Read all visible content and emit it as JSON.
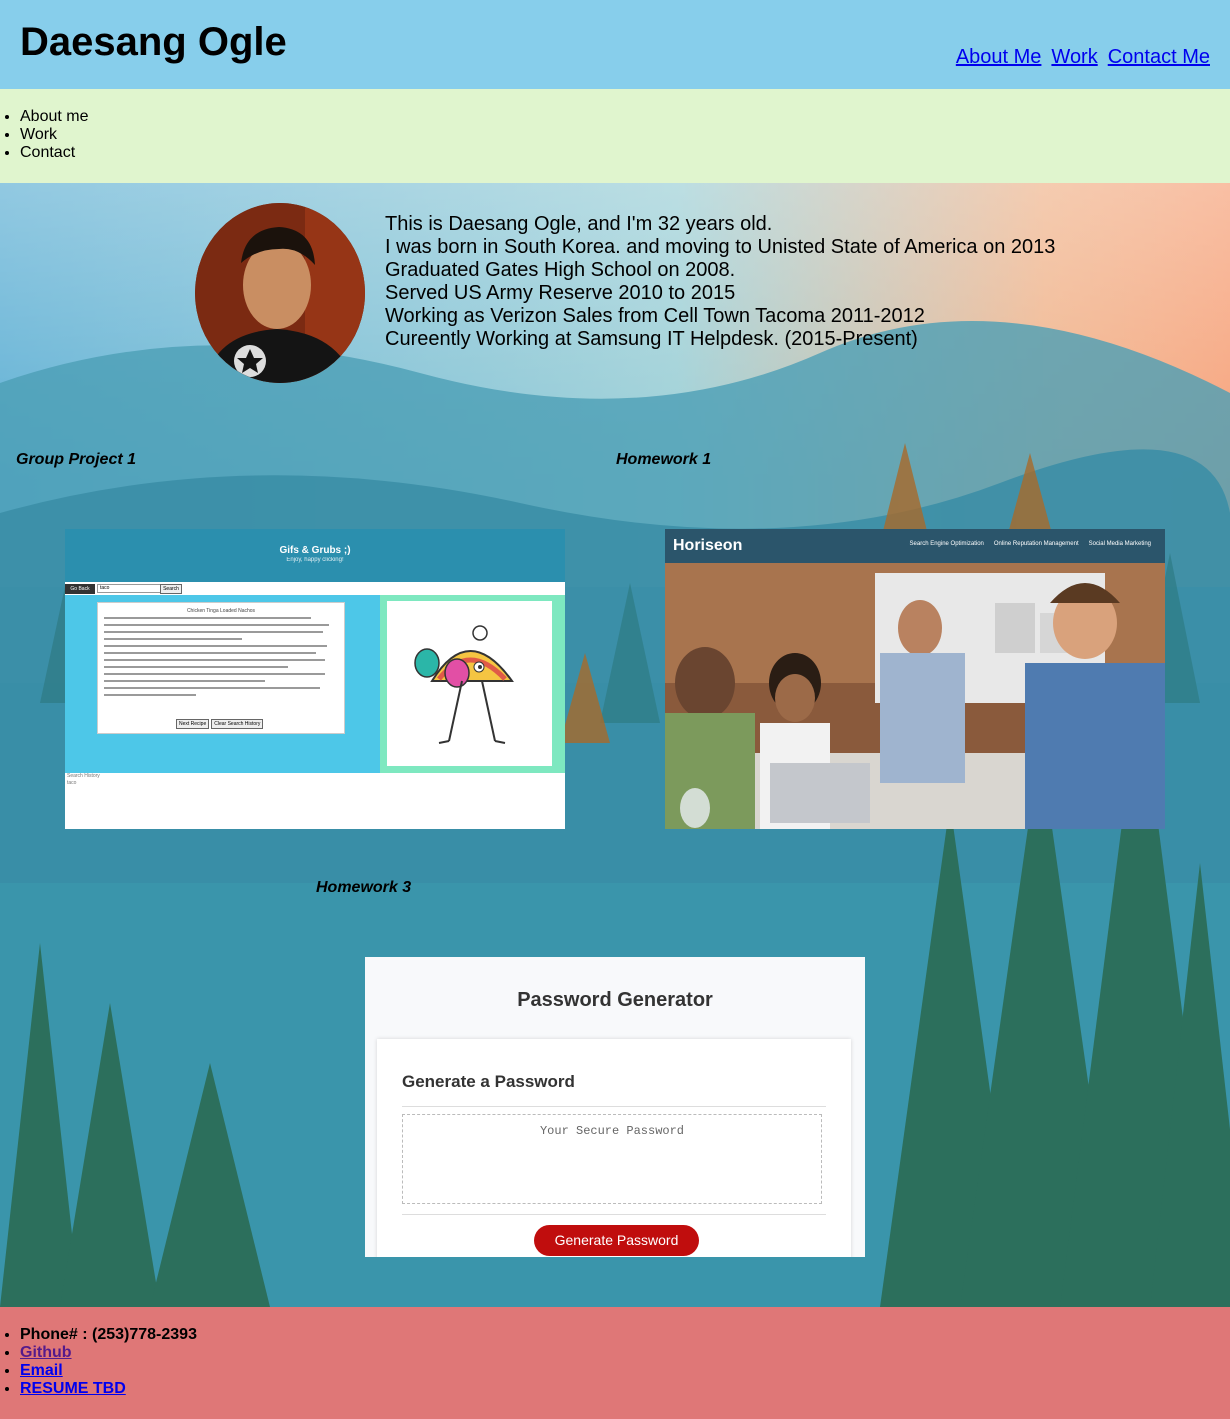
{
  "header": {
    "title": "Daesang Ogle",
    "nav": [
      "About Me",
      "Work",
      "Contact Me"
    ]
  },
  "side_nav": [
    "About me",
    "Work",
    "Contact"
  ],
  "about": {
    "lines": [
      "This is Daesang Ogle, and I'm 32 years old.",
      "I was born in South Korea. and moving to Unisted State of America on 2013",
      "Graduated Gates High School on 2008.",
      "Served US Army Reserve 2010 to 2015",
      "Working as Verizon Sales from Cell Town Tacoma 2011-2012",
      "Cureently Working at Samsung IT Helpdesk. (2015-Present)"
    ]
  },
  "work": {
    "projects": [
      {
        "label": "Group Project 1",
        "preview": {
          "title": "Gifs & Grubs ;)",
          "subtitle": "Enjoy, happy clicking!",
          "back": "Go Back",
          "input": "taco",
          "search": "Search",
          "recipe_title": "Chicken Tinga Loaded Nachos",
          "buttons": [
            "Next Recipe",
            "Clear Search History"
          ],
          "history_title": "Search History",
          "history_item": "taco"
        }
      },
      {
        "label": "Homework 1",
        "preview": {
          "logo": "Horiseon",
          "nav": [
            "Search Engine Optimization",
            "Online Reputation Management",
            "Social Media Marketing"
          ]
        }
      },
      {
        "label": "Homework 3",
        "preview": {
          "title": "Password Generator",
          "card_title": "Generate a Password",
          "placeholder": "Your Secure Password",
          "button": "Generate Password"
        }
      }
    ]
  },
  "footer": {
    "phone": "Phone# : (253)778-2393",
    "links": [
      "Github",
      "Email",
      "RESUME TBD"
    ]
  },
  "colors": {
    "header_bg": "#87ceeb",
    "side_nav_bg": "#e0f5ce",
    "footer_bg": "#df7777",
    "link": "#0000ee",
    "visited_link": "#551a8b",
    "pw_button": "#c00d0d"
  }
}
